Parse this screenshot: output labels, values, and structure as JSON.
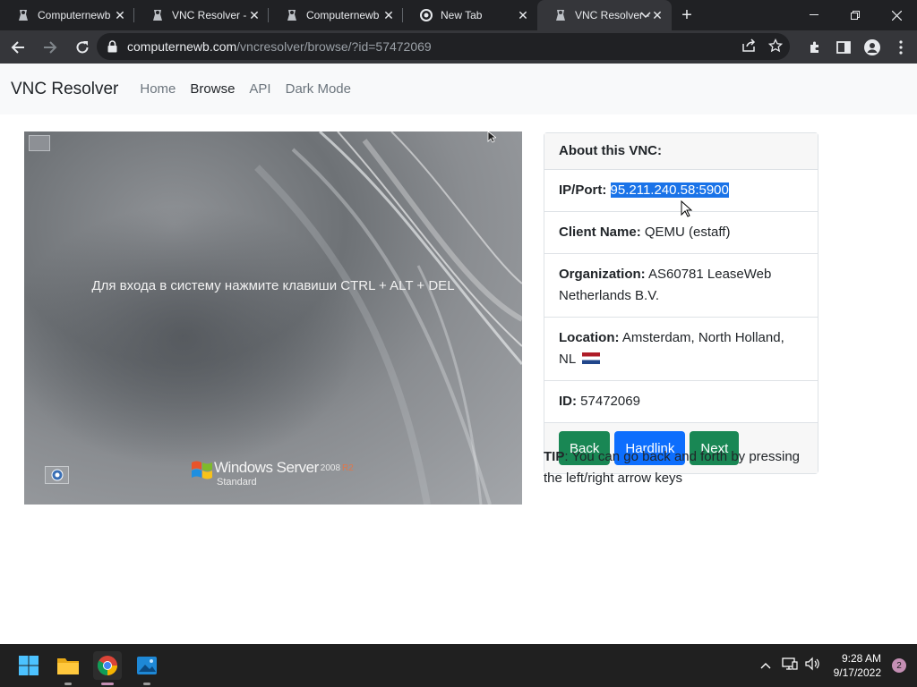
{
  "browser": {
    "tabs": [
      {
        "title": "Computernewb",
        "icon": "computernewb-icon",
        "active": false
      },
      {
        "title": "VNC Resolver - ",
        "icon": "computernewb-icon",
        "active": false
      },
      {
        "title": "Computernewb",
        "icon": "computernewb-icon",
        "active": false
      },
      {
        "title": "New Tab",
        "icon": "chrome-icon",
        "active": false
      },
      {
        "title": "VNC Resolver - ",
        "icon": "computernewb-icon",
        "active": true
      }
    ],
    "url_host": "computernewb.com",
    "url_path": "/vncresolver/browse/?id=57472069"
  },
  "site": {
    "brand": "VNC Resolver",
    "nav": [
      "Home",
      "Browse",
      "API",
      "Dark Mode"
    ],
    "active_nav": "Browse"
  },
  "screenshot": {
    "logon_text": "Для входа в систему нажмите клавиши CTRL + ALT + DEL",
    "product": "Windows Server",
    "version": "2008",
    "release": "R2",
    "edition": "Standard"
  },
  "card": {
    "header": "About this VNC:",
    "ip_label": "IP/Port:",
    "ip_value": "95.211.240.58:5900",
    "client_label": "Client Name:",
    "client_value": "QEMU (estaff)",
    "org_label": "Organization:",
    "org_value": "AS60781 LeaseWeb Netherlands B.V.",
    "location_label": "Location:",
    "location_value": "Amsterdam, North Holland, NL",
    "id_label": "ID:",
    "id_value": "57472069",
    "buttons": {
      "back": "Back",
      "hardlink": "Hardlink",
      "next": "Next"
    }
  },
  "tip": {
    "label": "TIP",
    "text": ": You can go back and forth by pressing the left/right arrow keys"
  },
  "taskbar": {
    "time": "9:28 AM",
    "date": "9/17/2022",
    "notification_count": "2"
  },
  "colors": {
    "selection": "#1a73e8",
    "button_green": "#198754",
    "button_blue": "#0d6efd"
  }
}
